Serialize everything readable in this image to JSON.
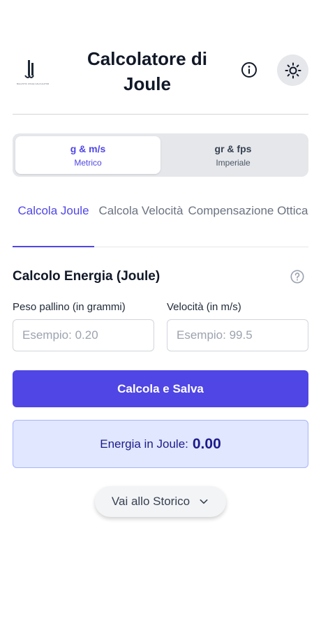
{
  "header": {
    "title": "Calcolatore di Joule",
    "logo_text": "BALLISTIC JOULE CALCULATOR",
    "info_icon": "info-icon",
    "theme_icon": "sun-icon"
  },
  "unit_toggle": {
    "options": [
      {
        "main": "g & m/s",
        "sub": "Metrico",
        "active": true
      },
      {
        "main": "gr & fps",
        "sub": "Imperiale",
        "active": false
      }
    ]
  },
  "tabs": [
    {
      "label": "Calcola Joule",
      "active": true
    },
    {
      "label": "Calcola Velocità",
      "active": false
    },
    {
      "label": "Compensazione Ottica",
      "active": false
    }
  ],
  "form": {
    "title": "Calcolo Energia (Joule)",
    "help_icon": "help-circle-icon",
    "weight_label": "Peso pallino (in grammi)",
    "weight_placeholder": "Esempio: 0.20",
    "weight_value": "",
    "velocity_label": "Velocità (in m/s)",
    "velocity_placeholder": "Esempio: 99.5",
    "velocity_value": "",
    "submit_label": "Calcola e Salva"
  },
  "result": {
    "label": "Energia in Joule:",
    "value": "0.00"
  },
  "history": {
    "label": "Vai allo Storico",
    "icon": "chevron-down-icon"
  },
  "colors": {
    "accent": "#4f46e5",
    "result_bg": "#e0e7ff",
    "result_text": "#1e1b8a"
  }
}
